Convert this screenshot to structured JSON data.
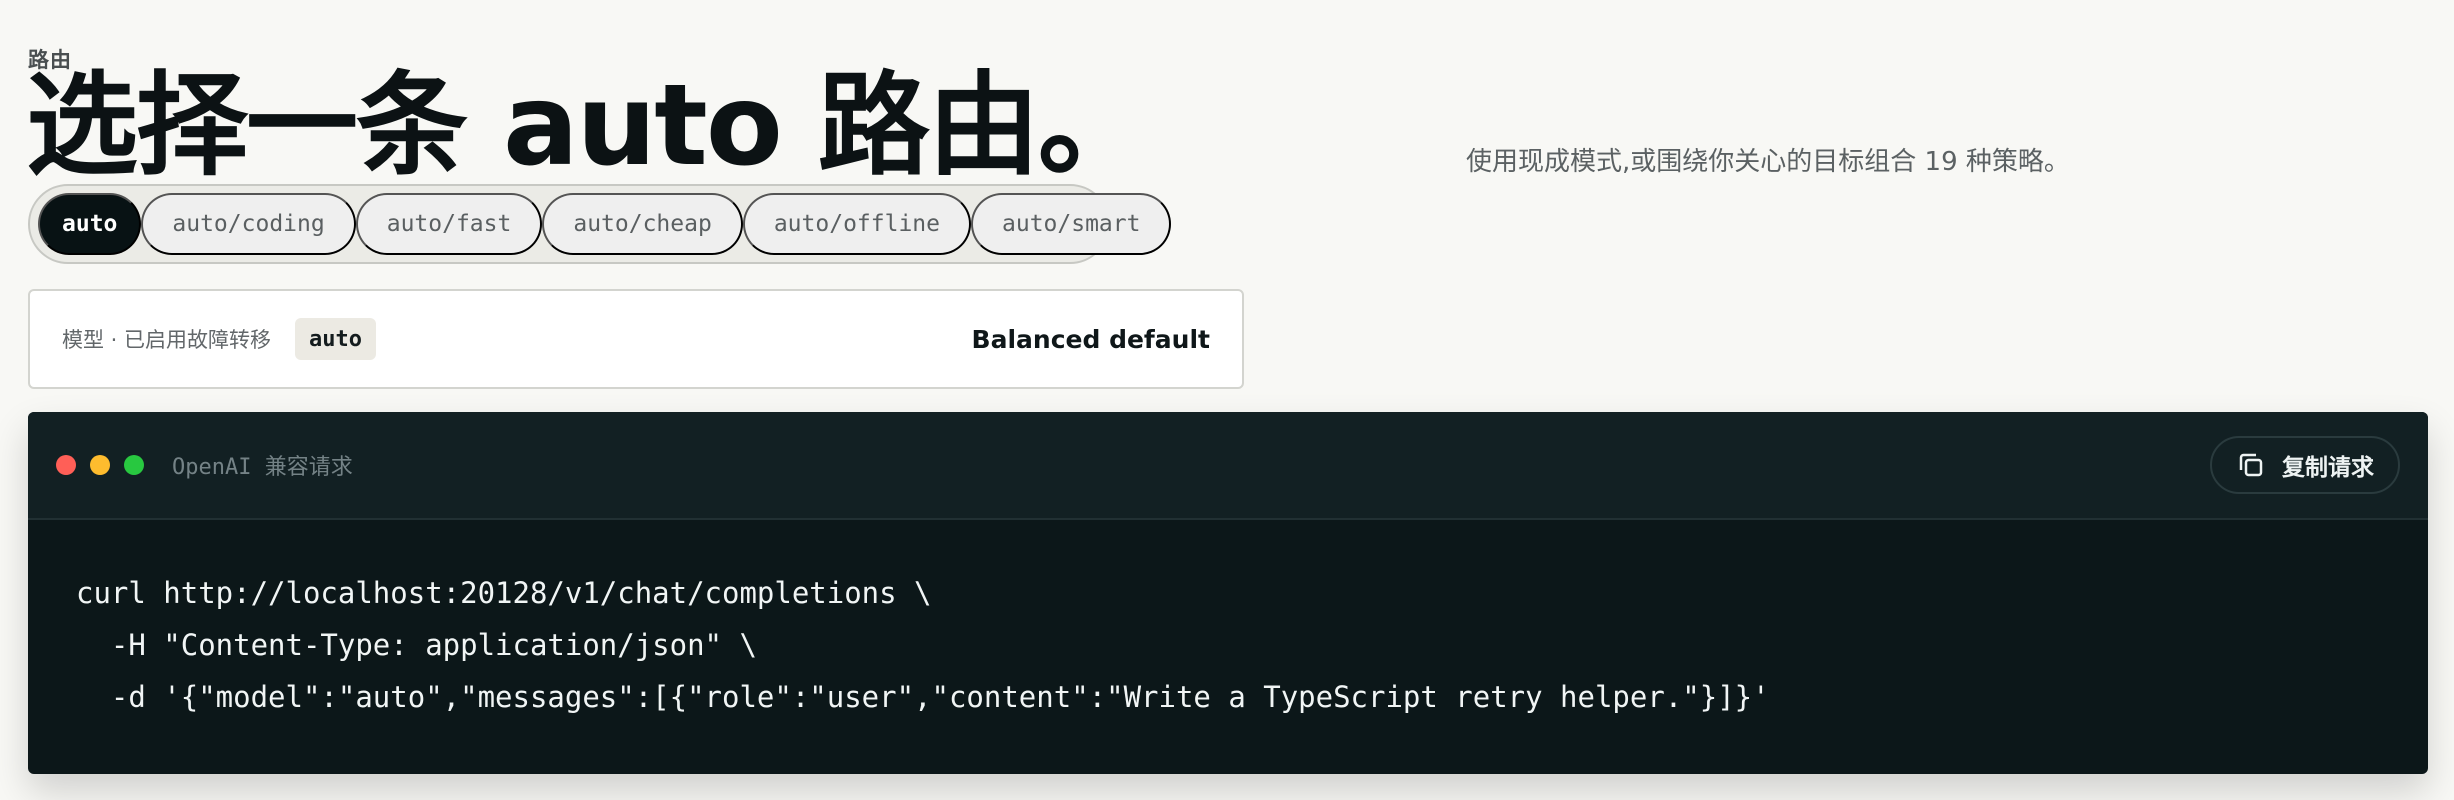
{
  "header": {
    "eyebrow": "路由",
    "title": "选择一条 auto 路由。",
    "subtitle": "使用现成模式,或围绕你关心的目标组合 19 种策略。"
  },
  "route_tabs": [
    {
      "label": "auto",
      "active": true
    },
    {
      "label": "auto/coding",
      "active": false
    },
    {
      "label": "auto/fast",
      "active": false
    },
    {
      "label": "auto/cheap",
      "active": false
    },
    {
      "label": "auto/offline",
      "active": false
    },
    {
      "label": "auto/smart",
      "active": false
    }
  ],
  "model_card": {
    "label": "模型 · 已启用故障转移",
    "model": "auto",
    "description": "Balanced default"
  },
  "terminal": {
    "title": "OpenAI 兼容请求",
    "copy_label": "复制请求",
    "copy_icon": "copy-icon",
    "window_controls": [
      {
        "name": "close",
        "color": "#ff5f57"
      },
      {
        "name": "minimize",
        "color": "#febc2e"
      },
      {
        "name": "maximize",
        "color": "#28c840"
      }
    ],
    "code_lines": [
      "curl http://localhost:20128/v1/chat/completions \\",
      "  -H \"Content-Type: application/json\" \\",
      "  -d '{\"model\":\"auto\",\"messages\":[{\"role\":\"user\",\"content\":\"Write a TypeScript retry helper.\"}]}'"
    ]
  }
}
